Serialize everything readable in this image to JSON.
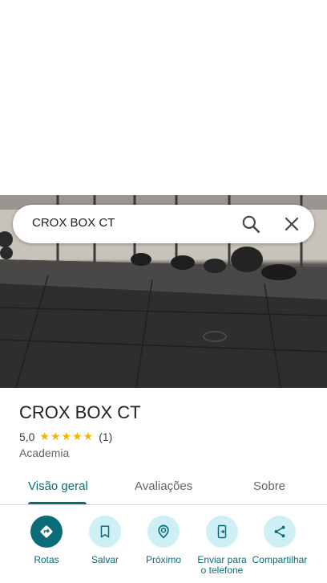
{
  "search": {
    "query": "CROX BOX CT"
  },
  "place": {
    "name": "CROX BOX CT",
    "rating": "5,0",
    "stars": "★★★★★",
    "review_count": "(1)",
    "category": "Academia"
  },
  "tabs": [
    {
      "label": "Visão geral",
      "active": true
    },
    {
      "label": "Avaliações",
      "active": false
    },
    {
      "label": "Sobre",
      "active": false
    }
  ],
  "actions": [
    {
      "label": "Rotas",
      "icon": "directions-icon"
    },
    {
      "label": "Salvar",
      "icon": "bookmark-icon"
    },
    {
      "label": "Próximo",
      "icon": "nearby-icon"
    },
    {
      "label": "Enviar para o telefone",
      "icon": "send-to-phone-icon"
    },
    {
      "label": "Compartilhar",
      "icon": "share-icon"
    }
  ],
  "colors": {
    "accent": "#0b6c79",
    "action_bg": "#cfeff7",
    "star": "#f4b400"
  }
}
